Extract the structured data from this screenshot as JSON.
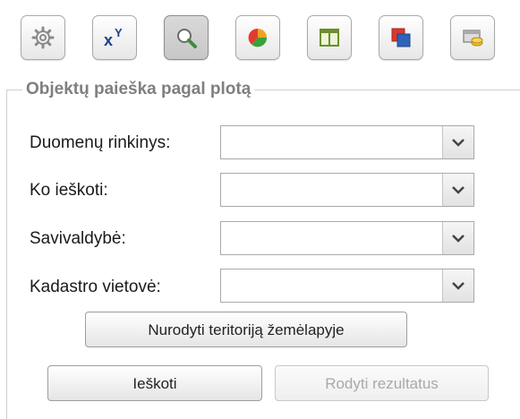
{
  "toolbar": {
    "buttons": [
      {
        "icon": "gear-icon"
      },
      {
        "icon": "xy-coordinates-icon",
        "label_x": "x",
        "label_y": "Y"
      },
      {
        "icon": "magnifier-icon",
        "active": true
      },
      {
        "icon": "pie-chart-icon"
      },
      {
        "icon": "table-icon"
      },
      {
        "icon": "layers-icon"
      },
      {
        "icon": "database-coins-icon"
      }
    ]
  },
  "search_panel": {
    "legend": "Objektų paieška pagal plotą",
    "fields": [
      {
        "label": "Duomenų rinkinys:",
        "value": ""
      },
      {
        "label": "Ko ieškoti:",
        "value": ""
      },
      {
        "label": "Savivaldybė:",
        "value": ""
      },
      {
        "label": "Kadastro vietovė:",
        "value": ""
      }
    ],
    "define_area_button": "Nurodyti teritoriją žemėlapyje",
    "search_button": "Ieškoti",
    "show_results_button": "Rodyti rezultatus"
  },
  "colors": {
    "legend_text": "#7f7f7f",
    "disabled_text": "#a9a9a9",
    "active_button_bg": "#cfcfcf"
  }
}
